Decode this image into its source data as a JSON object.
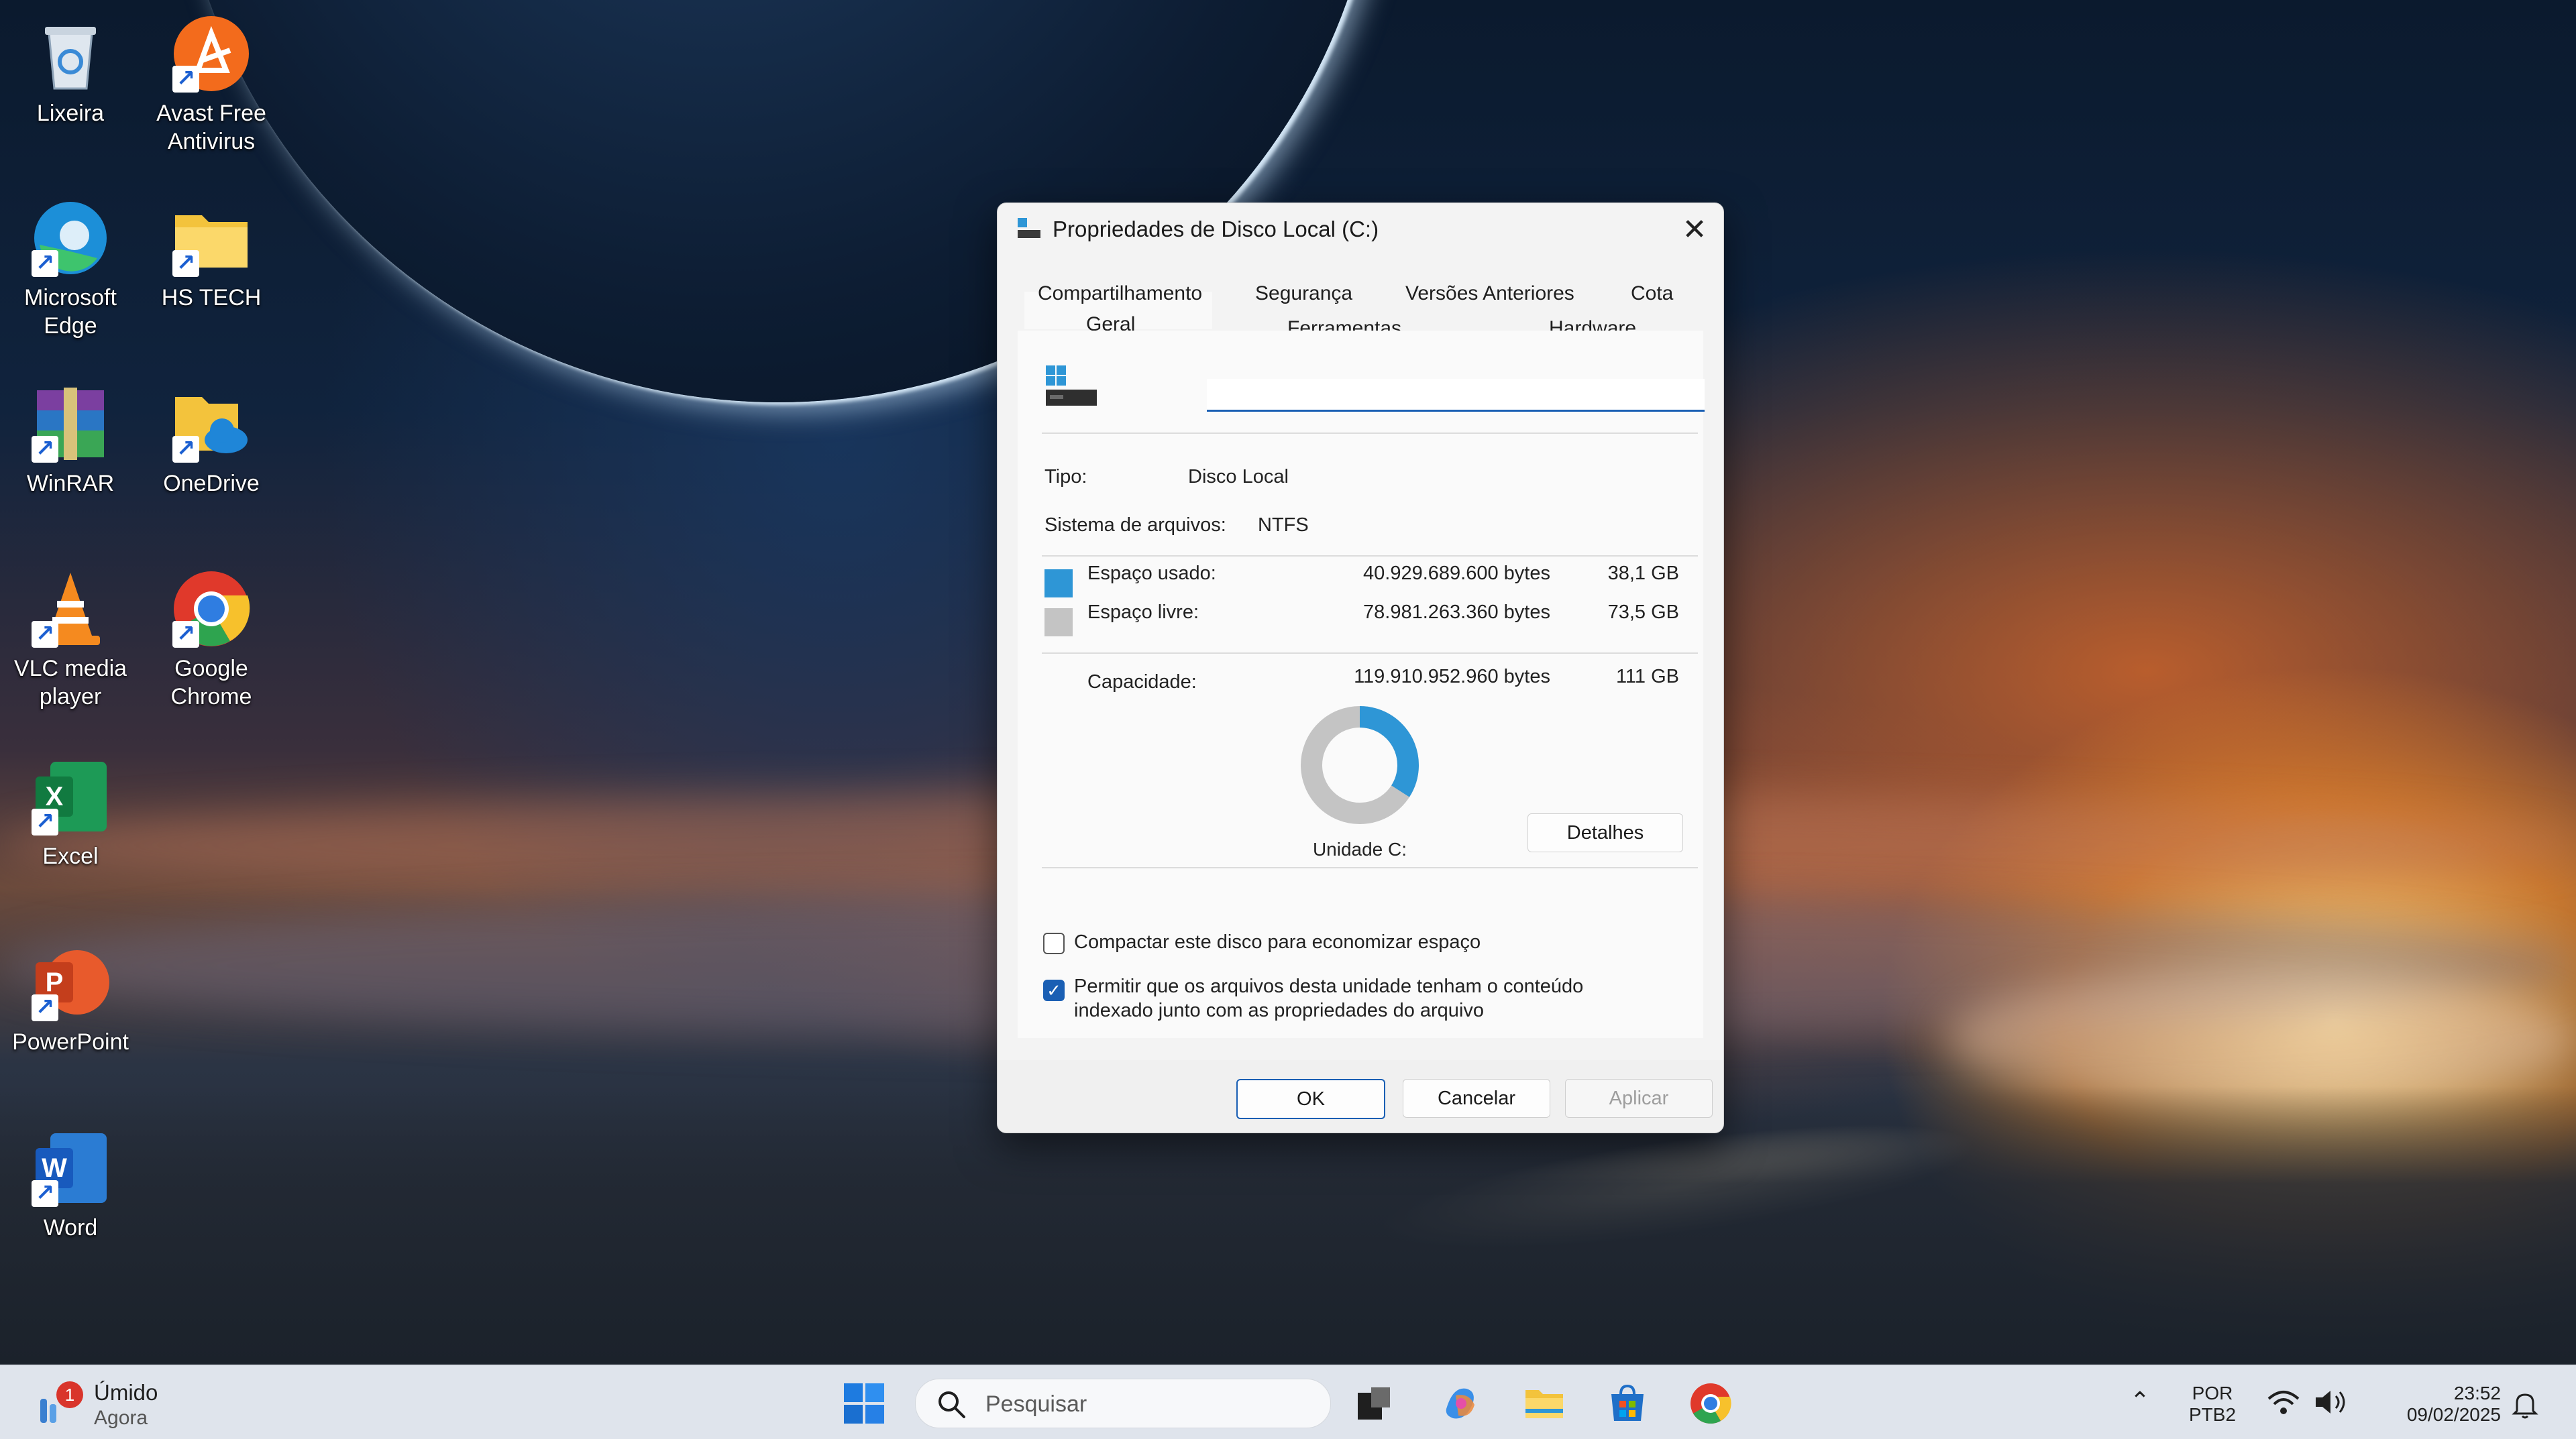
{
  "desktop": {
    "icons": [
      {
        "label": "Lixeira"
      },
      {
        "label": "Avast Free Antivirus"
      },
      {
        "label": "Microsoft Edge"
      },
      {
        "label": "HS TECH"
      },
      {
        "label": "WinRAR"
      },
      {
        "label": "OneDrive"
      },
      {
        "label": "VLC media player"
      },
      {
        "label": "Google Chrome"
      },
      {
        "label": "Excel"
      },
      {
        "label": "PowerPoint"
      },
      {
        "label": "Word"
      }
    ]
  },
  "dialog": {
    "title": "Propriedades de Disco Local (C:)",
    "tabs_row1": [
      "Compartilhamento",
      "Segurança",
      "Versões Anteriores",
      "Cota"
    ],
    "tabs_row2": [
      "Geral",
      "Ferramentas",
      "Hardware"
    ],
    "active_tab": "Geral",
    "name_value": "",
    "type_label": "Tipo:",
    "type_value": "Disco Local",
    "fs_label": "Sistema de arquivos:",
    "fs_value": "NTFS",
    "used_label": "Espaço usado:",
    "used_bytes": "40.929.689.600 bytes",
    "used_gb": "38,1 GB",
    "free_label": "Espaço livre:",
    "free_bytes": "78.981.263.360 bytes",
    "free_gb": "73,5 GB",
    "capacity_label": "Capacidade:",
    "capacity_bytes": "119.910.952.960 bytes",
    "capacity_gb": "111 GB",
    "drive_label": "Unidade C:",
    "details_button": "Detalhes",
    "used_fraction": 0.341,
    "compress_label": "Compactar este disco para economizar espaço",
    "compress_checked": false,
    "index_label_line1": "Permitir que os arquivos desta unidade tenham o conteúdo",
    "index_label_line2": "indexado junto com as propriedades do arquivo",
    "index_checked": true,
    "ok": "OK",
    "cancel": "Cancelar",
    "apply": "Aplicar",
    "colors": {
      "used": "#2e96d6",
      "free": "#c4c4c4",
      "accent": "#1a5fb4"
    }
  },
  "taskbar": {
    "weather_badge": "1",
    "weather_title": "Úmido",
    "weather_sub": "Agora",
    "search_placeholder": "Pesquisar",
    "lang_line1": "POR",
    "lang_line2": "PTB2",
    "time": "23:52",
    "date": "09/02/2025"
  }
}
